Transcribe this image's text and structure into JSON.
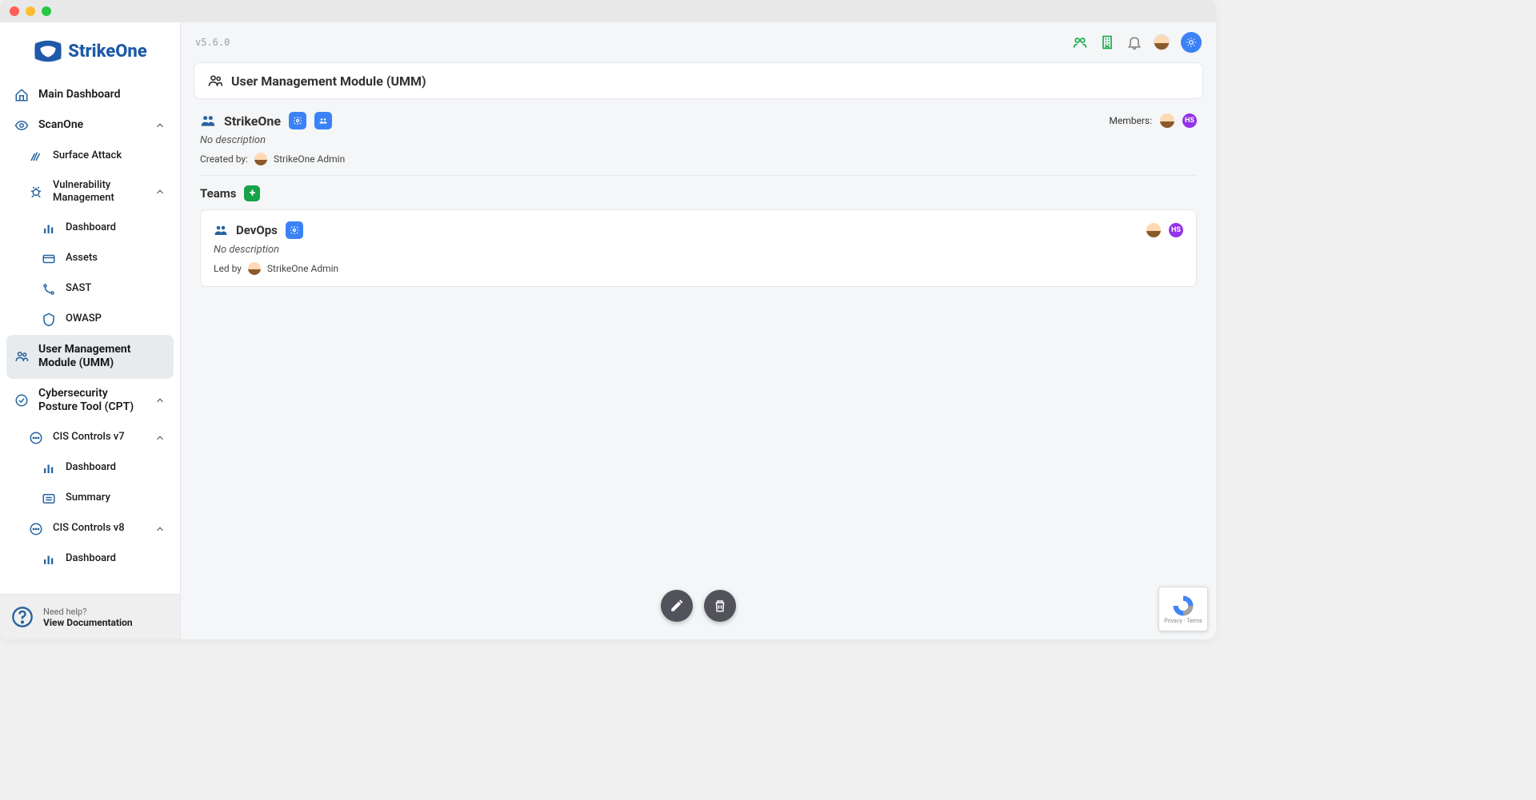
{
  "brand": "StrikeOne",
  "version": "v5.6.0",
  "sidebar": {
    "main_dashboard": "Main Dashboard",
    "scanone": {
      "label": "ScanOne",
      "surface_attack": "Surface Attack",
      "vuln_mgmt": {
        "label": "Vulnerability Management",
        "dashboard": "Dashboard",
        "assets": "Assets",
        "sast": "SAST",
        "owasp": "OWASP"
      }
    },
    "umm": "User Management Module (UMM)",
    "cpt": {
      "label": "Cybersecurity Posture Tool (CPT)",
      "cis7": {
        "label": "CIS Controls v7",
        "dashboard": "Dashboard",
        "summary": "Summary"
      },
      "cis8": {
        "label": "CIS Controls v8",
        "dashboard": "Dashboard"
      }
    },
    "help": {
      "q": "Need help?",
      "link": "View Documentation"
    }
  },
  "page": {
    "title": "User Management Module (UMM)",
    "org": {
      "name": "StrikeOne",
      "description": "No description",
      "created_by_label": "Created by:",
      "created_by_name": "StrikeOne Admin",
      "members_label": "Members:",
      "member_initials": "HS"
    },
    "teams": {
      "label": "Teams",
      "items": [
        {
          "name": "DevOps",
          "description": "No description",
          "led_by_label": "Led by",
          "led_by_name": "StrikeOne Admin",
          "member_initials": "HS"
        }
      ]
    }
  },
  "recaptcha_text": "Privacy - Terms"
}
